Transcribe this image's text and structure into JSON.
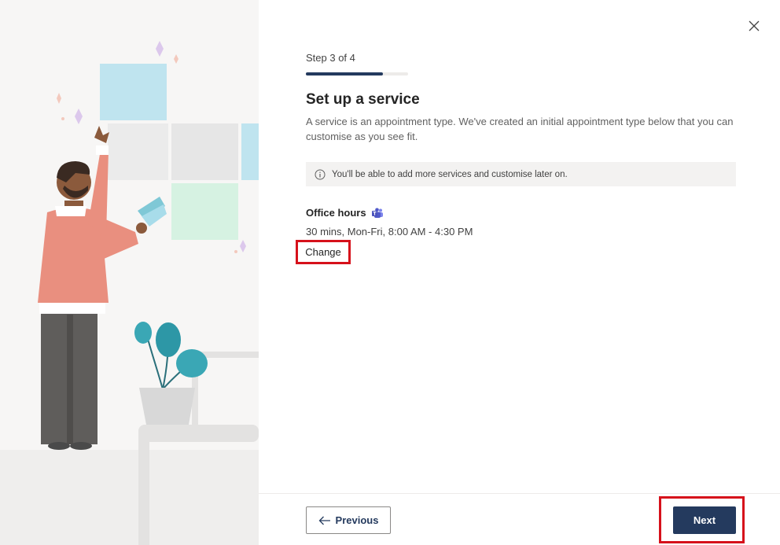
{
  "wizard": {
    "step_label": "Step 3 of 4",
    "step_current": 3,
    "step_total": 4,
    "progress_fraction": 0.75,
    "title": "Set up a service",
    "description": "A service is an appointment type. We've created an initial appointment type below that you can customise as you see fit.",
    "info_message": "You'll be able to add more services and customise later on.",
    "service": {
      "name": "Office hours",
      "details": "30 mins, Mon-Fri, 8:00 AM - 4:30 PM",
      "change_label": "Change",
      "icon": "teams-icon"
    }
  },
  "footer": {
    "previous_label": "Previous",
    "next_label": "Next"
  },
  "colors": {
    "accent": "#243a5e",
    "highlight": "#d6111b",
    "info_bg": "#f3f2f1"
  },
  "icons": {
    "close": "close-icon",
    "info": "info-icon",
    "back": "arrow-left-icon"
  }
}
